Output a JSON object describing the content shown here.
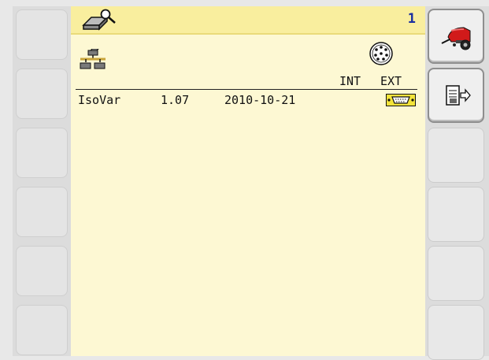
{
  "header": {
    "page_number": "1",
    "title_icon": "eraser-magnifier-icon"
  },
  "table": {
    "section_icon": "network-modules-icon",
    "connector_icon": "round-connector-icon",
    "columns": {
      "int": "INT",
      "ext": "EXT"
    },
    "rows": [
      {
        "name": "IsoVar",
        "version": "1.07",
        "date": "2010-10-21",
        "ext_icon": "serial-port-icon"
      }
    ]
  },
  "softkeys": {
    "left": [
      "",
      "",
      "",
      "",
      "",
      ""
    ],
    "right_icons": [
      "baler-machine-icon",
      "document-export-icon",
      "",
      "",
      "",
      ""
    ]
  },
  "colors": {
    "panel_background": "#fdf8d3",
    "titlebar": "#f9ee9e",
    "page_number": "#1a2fa0",
    "accent_red": "#d11a1a"
  }
}
